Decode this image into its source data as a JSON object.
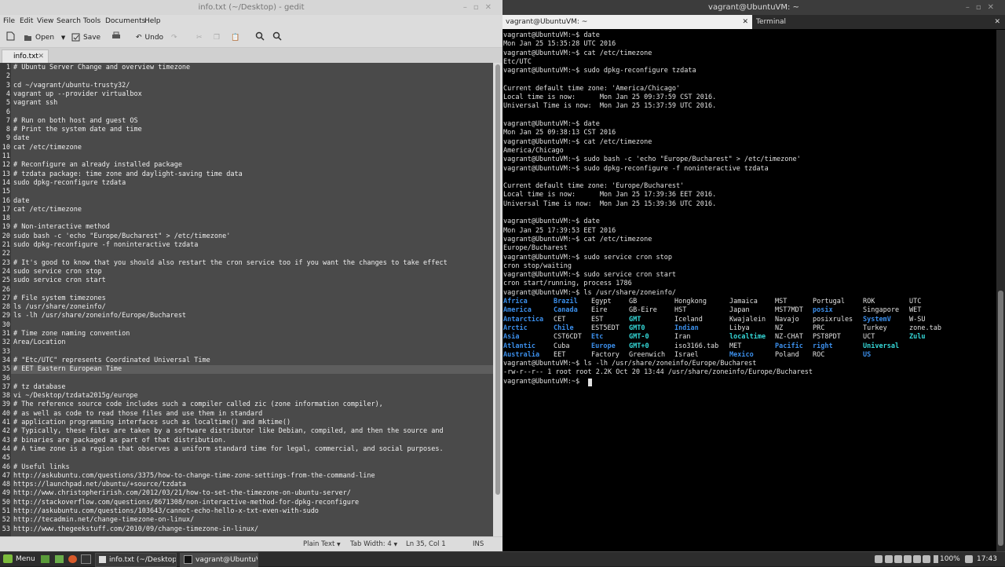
{
  "gedit": {
    "title": "info.txt (~/Desktop) - gedit",
    "menu": [
      "File",
      "Edit",
      "View",
      "Search",
      "Tools",
      "Documents",
      "Help"
    ],
    "toolbar": {
      "open": "Open",
      "save": "Save",
      "undo": "Undo"
    },
    "tab": "info.txt",
    "lines": [
      "# Ubuntu Server Change and overview timezone",
      "",
      "cd ~/vagrant/ubuntu-trusty32/",
      "vagrant up --provider virtualbox",
      "vagrant ssh",
      "",
      "# Run on both host and guest OS",
      "# Print the system date and time",
      "date",
      "cat /etc/timezone",
      "",
      "# Reconfigure an already installed package",
      "# tzdata package: time zone and daylight-saving time data",
      "sudo dpkg-reconfigure tzdata",
      "",
      "date",
      "cat /etc/timezone",
      "",
      "# Non-interactive method",
      "sudo bash -c 'echo \"Europe/Bucharest\" > /etc/timezone'",
      "sudo dpkg-reconfigure -f noninteractive tzdata",
      "",
      "# It's good to know that you should also restart the cron service too if you want the changes to take effect",
      "sudo service cron stop",
      "sudo service cron start",
      "",
      "# File system timezones",
      "ls /usr/share/zoneinfo/",
      "ls -lh /usr/share/zoneinfo/Europe/Bucharest",
      "",
      "# Time zone naming convention",
      "Area/Location",
      "",
      "# \"Etc/UTC\" represents Coordinated Universal Time",
      "# EET Eastern European Time",
      "",
      "# tz database",
      "vi ~/Desktop/tzdata2015g/europe",
      "# The reference source code includes such a compiler called zic (zone information compiler),",
      "# as well as code to read those files and use them in standard",
      "# application programming interfaces such as localtime() and mktime()",
      "# Typically, these files are taken by a software distributor like Debian, compiled, and then the source and",
      "# binaries are packaged as part of that distribution.",
      "# A time zone is a region that observes a uniform standard time for legal, commercial, and social purposes.",
      "",
      "# Useful links",
      "http://askubuntu.com/questions/3375/how-to-change-time-zone-settings-from-the-command-line",
      "https://launchpad.net/ubuntu/+source/tzdata",
      "http://www.christopherirish.com/2012/03/21/how-to-set-the-timezone-on-ubuntu-server/",
      "http://stackoverflow.com/questions/8671308/non-interactive-method-for-dpkg-reconfigure",
      "http://askubuntu.com/questions/103643/cannot-echo-hello-x-txt-even-with-sudo",
      "http://tecadmin.net/change-timezone-on-linux/",
      "http://www.thegeekstuff.com/2010/09/change-timezone-in-linux/"
    ],
    "status": {
      "syntax": "Plain Text",
      "tab_width": "Tab Width: 4",
      "position": "Ln 35, Col 1",
      "mode": "INS"
    }
  },
  "terminal": {
    "title": "vagrant@UbuntuVM: ~",
    "tabs": [
      "vagrant@UbuntuVM: ~",
      "Terminal"
    ],
    "lines": [
      "vagrant@UbuntuVM:~$ date",
      "Mon Jan 25 15:35:28 UTC 2016",
      "vagrant@UbuntuVM:~$ cat /etc/timezone",
      "Etc/UTC",
      "vagrant@UbuntuVM:~$ sudo dpkg-reconfigure tzdata",
      "",
      "Current default time zone: 'America/Chicago'",
      "Local time is now:      Mon Jan 25 09:37:59 CST 2016.",
      "Universal Time is now:  Mon Jan 25 15:37:59 UTC 2016.",
      "",
      "vagrant@UbuntuVM:~$ date",
      "Mon Jan 25 09:38:13 CST 2016",
      "vagrant@UbuntuVM:~$ cat /etc/timezone",
      "America/Chicago",
      "vagrant@UbuntuVM:~$ sudo bash -c 'echo \"Europe/Bucharest\" > /etc/timezone'",
      "vagrant@UbuntuVM:~$ sudo dpkg-reconfigure -f noninteractive tzdata",
      "",
      "Current default time zone: 'Europe/Bucharest'",
      "Local time is now:      Mon Jan 25 17:39:36 EET 2016.",
      "Universal Time is now:  Mon Jan 25 15:39:36 UTC 2016.",
      "",
      "vagrant@UbuntuVM:~$ date",
      "Mon Jan 25 17:39:53 EET 2016",
      "vagrant@UbuntuVM:~$ cat /etc/timezone",
      "Europe/Bucharest",
      "vagrant@UbuntuVM:~$ sudo service cron stop",
      "cron stop/waiting",
      "vagrant@UbuntuVM:~$ sudo service cron start",
      "cron start/running, process 1786",
      "vagrant@UbuntuVM:~$ ls /usr/share/zoneinfo/"
    ],
    "ls_rows": [
      [
        [
          "Africa",
          "d"
        ],
        [
          "Brazil",
          "d"
        ],
        [
          "Egypt",
          "f"
        ],
        [
          "GB",
          "f"
        ],
        [
          "Hongkong",
          "f"
        ],
        [
          "Jamaica",
          "f"
        ],
        [
          "MST",
          "f"
        ],
        [
          "Portugal",
          "f"
        ],
        [
          "ROK",
          "f"
        ],
        [
          "UTC",
          "f"
        ]
      ],
      [
        [
          "America",
          "d"
        ],
        [
          "Canada",
          "d"
        ],
        [
          "Eire",
          "f"
        ],
        [
          "GB-Eire",
          "f"
        ],
        [
          "HST",
          "f"
        ],
        [
          "Japan",
          "f"
        ],
        [
          "MST7MDT",
          "f"
        ],
        [
          "posix",
          "d"
        ],
        [
          "Singapore",
          "f"
        ],
        [
          "WET",
          "f"
        ]
      ],
      [
        [
          "Antarctica",
          "d"
        ],
        [
          "CET",
          "f"
        ],
        [
          "EST",
          "f"
        ],
        [
          "GMT",
          "l"
        ],
        [
          "Iceland",
          "f"
        ],
        [
          "Kwajalein",
          "f"
        ],
        [
          "Navajo",
          "f"
        ],
        [
          "posixrules",
          "f"
        ],
        [
          "SystemV",
          "d"
        ],
        [
          "W-SU",
          "f"
        ]
      ],
      [
        [
          "Arctic",
          "d"
        ],
        [
          "Chile",
          "d"
        ],
        [
          "EST5EDT",
          "f"
        ],
        [
          "GMT0",
          "l"
        ],
        [
          "Indian",
          "d"
        ],
        [
          "Libya",
          "f"
        ],
        [
          "NZ",
          "f"
        ],
        [
          "PRC",
          "f"
        ],
        [
          "Turkey",
          "f"
        ],
        [
          "zone.tab",
          "f"
        ]
      ],
      [
        [
          "Asia",
          "d"
        ],
        [
          "CST6CDT",
          "f"
        ],
        [
          "Etc",
          "d"
        ],
        [
          "GMT-0",
          "l"
        ],
        [
          "Iran",
          "f"
        ],
        [
          "localtime",
          "l"
        ],
        [
          "NZ-CHAT",
          "f"
        ],
        [
          "PST8PDT",
          "f"
        ],
        [
          "UCT",
          "f"
        ],
        [
          "Zulu",
          "l"
        ]
      ],
      [
        [
          "Atlantic",
          "d"
        ],
        [
          "Cuba",
          "f"
        ],
        [
          "Europe",
          "d"
        ],
        [
          "GMT+0",
          "l"
        ],
        [
          "iso3166.tab",
          "f"
        ],
        [
          "MET",
          "f"
        ],
        [
          "Pacific",
          "d"
        ],
        [
          "right",
          "d"
        ],
        [
          "Universal",
          "l"
        ],
        [
          "",
          ""
        ]
      ],
      [
        [
          "Australia",
          "d"
        ],
        [
          "EET",
          "f"
        ],
        [
          "Factory",
          "f"
        ],
        [
          "Greenwich",
          "f"
        ],
        [
          "Israel",
          "f"
        ],
        [
          "Mexico",
          "d"
        ],
        [
          "Poland",
          "f"
        ],
        [
          "ROC",
          "f"
        ],
        [
          "US",
          "d"
        ],
        [
          "",
          ""
        ]
      ]
    ],
    "after_ls": [
      "vagrant@UbuntuVM:~$ ls -lh /usr/share/zoneinfo/Europe/Bucharest",
      "-rw-r--r-- 1 root root 2.2K Oct 20 13:44 /usr/share/zoneinfo/Europe/Bucharest",
      "vagrant@UbuntuVM:~$ "
    ]
  },
  "taskbar": {
    "menu": "Menu",
    "tasks": [
      "info.txt (~/Desktop) ...",
      "vagrant@UbuntuV..."
    ],
    "battery": "100%",
    "clock": "17:43"
  }
}
